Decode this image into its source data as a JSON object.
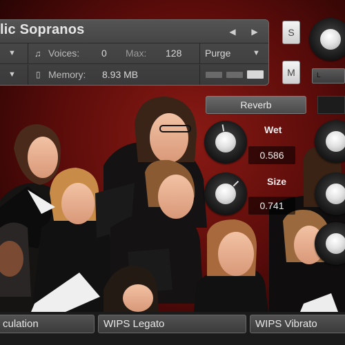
{
  "header": {
    "instrument_name": "lic Sopranos",
    "voices_label": "Voices:",
    "voices_value": "0",
    "max_label": "Max:",
    "max_value": "128",
    "purge_label": "Purge",
    "memory_label": "Memory:",
    "memory_value": "8.93 MB"
  },
  "buttons": {
    "solo": "S",
    "mute": "M",
    "tune_label": "L"
  },
  "controls": {
    "reverb_label": "Reverb",
    "wet_label": "Wet",
    "wet_value": "0.586",
    "size_label": "Size",
    "size_value": "0.741"
  },
  "tabs": [
    "culation",
    "WIPS Legato",
    "WIPS Vibrato"
  ],
  "colors": {
    "panel": "#444444",
    "backdrop": "#6a0e0c",
    "meter_off": "#6a6a6a",
    "meter_on": "#d8d8d8"
  },
  "icons": {
    "prev": "left-arrow-icon",
    "next": "right-arrow-icon",
    "voices": "notes-icon",
    "memory": "memory-icon"
  }
}
